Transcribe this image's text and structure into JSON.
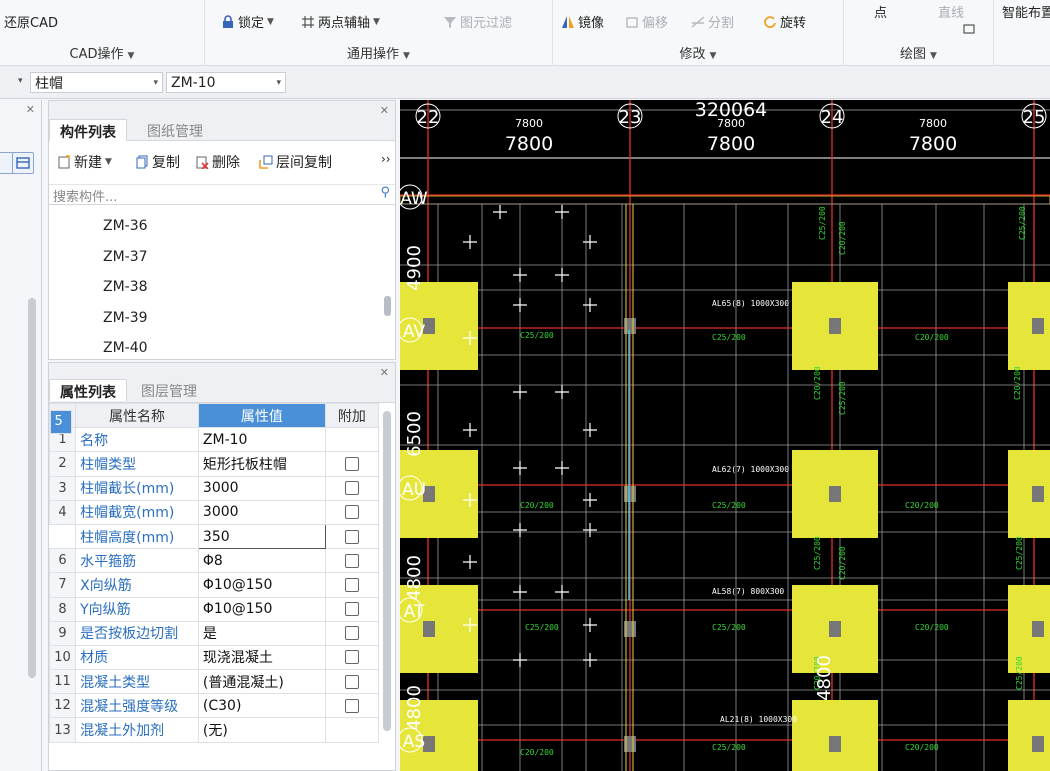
{
  "ribbon": {
    "cad_ops": {
      "restore_cad": "还原CAD",
      "label": "CAD操作"
    },
    "general_ops": {
      "lock": "锁定",
      "two_point_axis": "两点辅轴",
      "element_filter": "图元过滤",
      "label": "通用操作"
    },
    "modify": {
      "mirror": "镜像",
      "offset": "偏移",
      "split": "分割",
      "rotate": "旋转",
      "label": "修改"
    },
    "draw": {
      "point": "点",
      "line": "直线",
      "label": "绘图"
    },
    "smart_layout": "智能布置",
    "caret": "▼"
  },
  "selectors": {
    "category": "柱帽",
    "component": "ZM-10",
    "dropdown_glyph": "▾"
  },
  "component_list": {
    "tabs": [
      "构件列表",
      "图纸管理"
    ],
    "toolbar": {
      "new": "新建",
      "copy": "复制",
      "delete": "删除",
      "floor_copy": "层间复制",
      "more": "››"
    },
    "search_placeholder": "搜索构件...",
    "items": [
      "ZM-36",
      "ZM-37",
      "ZM-38",
      "ZM-39",
      "ZM-40"
    ]
  },
  "property_list": {
    "tabs": [
      "属性列表",
      "图层管理"
    ],
    "headers": {
      "name": "属性名称",
      "value": "属性值",
      "extra": "附加"
    },
    "rows": [
      {
        "idx": "1",
        "name": "名称",
        "value": "ZM-10",
        "check": false
      },
      {
        "idx": "2",
        "name": "柱帽类型",
        "value": "矩形托板柱帽",
        "check": true
      },
      {
        "idx": "3",
        "name": "柱帽截长(mm)",
        "value": "3000",
        "check": true
      },
      {
        "idx": "4",
        "name": "柱帽截宽(mm)",
        "value": "3000",
        "check": true
      },
      {
        "idx": "5",
        "name": "柱帽高度(mm)",
        "value": "350",
        "check": true
      },
      {
        "idx": "6",
        "name": "水平箍筋",
        "value": "Φ8",
        "check": true
      },
      {
        "idx": "7",
        "name": "X向纵筋",
        "value": "Φ10@150",
        "check": true
      },
      {
        "idx": "8",
        "name": "Y向纵筋",
        "value": "Φ10@150",
        "check": true
      },
      {
        "idx": "9",
        "name": "是否按板边切割",
        "value": "是",
        "check": true
      },
      {
        "idx": "10",
        "name": "材质",
        "value": "现浇混凝土",
        "check": true
      },
      {
        "idx": "11",
        "name": "混凝土类型",
        "value": "(普通混凝土)",
        "check": true
      },
      {
        "idx": "12",
        "name": "混凝土强度等级",
        "value": "(C30)",
        "check": true
      },
      {
        "idx": "13",
        "name": "混凝土外加剂",
        "value": "(无)",
        "check": false
      }
    ]
  },
  "canvas": {
    "axes_top": [
      "22",
      "23",
      "24",
      "25"
    ],
    "dim_small": "7800",
    "dim_big": "7800",
    "top_dim": "320064",
    "axes_left": [
      "AW",
      "AV",
      "AU",
      "AT",
      "AS"
    ],
    "left_dims": [
      "4900",
      "6500",
      "4800",
      "4800"
    ],
    "mid_dim": "4800",
    "labels": {
      "al_rows": [
        "AL65(8) 1000X300",
        "AL62(7) 1000X300",
        "AL58(7) 800X300",
        "AL21(8) 1000X300"
      ],
      "c25": "C25/200",
      "c20": "C20/200"
    },
    "colors": {
      "grid_red": "#e0302b",
      "cap_yellow": "#e6e63a",
      "line_white": "#ffffff",
      "text_green": "#35d535"
    }
  }
}
